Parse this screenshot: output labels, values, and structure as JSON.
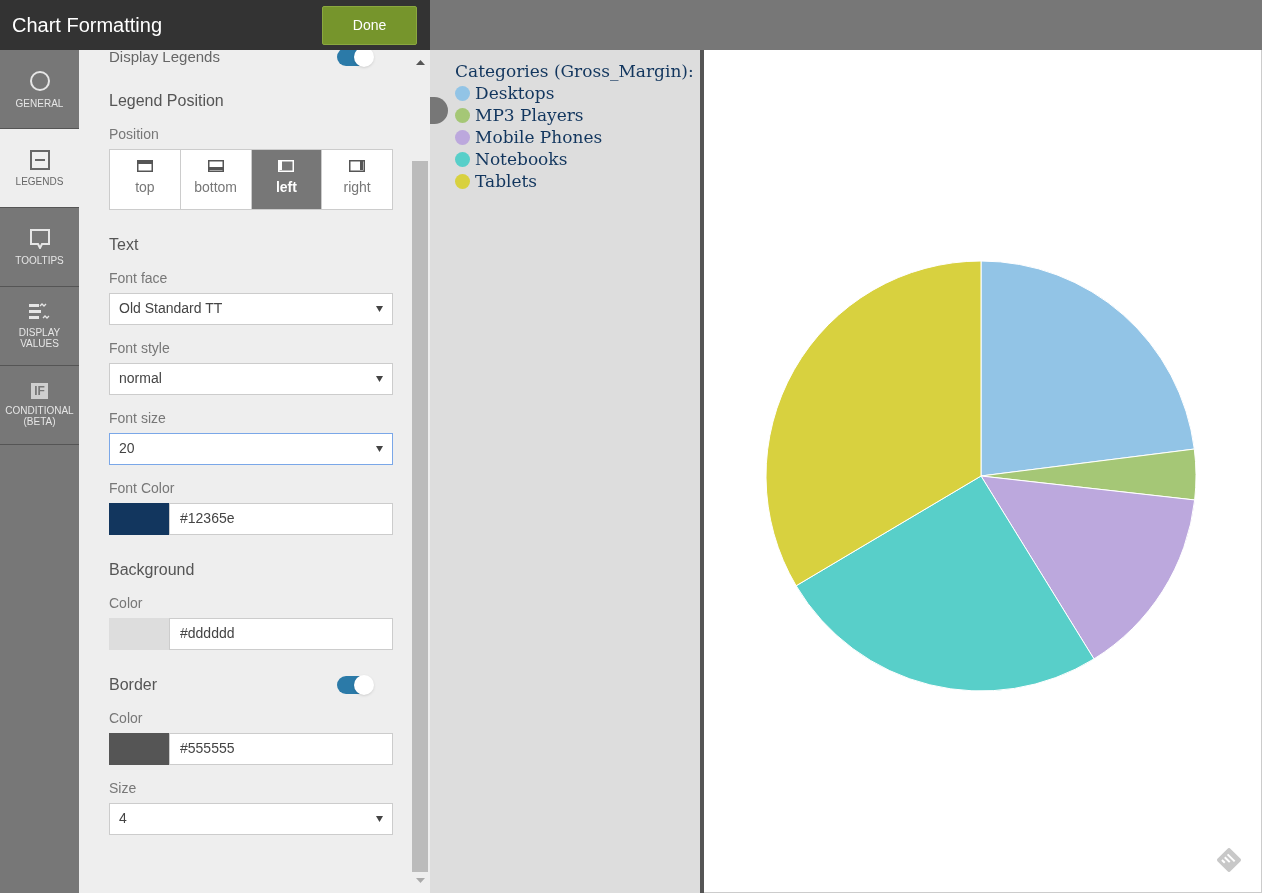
{
  "header": {
    "title": "Chart Formatting",
    "done_button": "Done"
  },
  "tabs": [
    {
      "kind": "circle",
      "label": "GENERAL",
      "selected": false
    },
    {
      "kind": "legend",
      "label": "LEGENDS",
      "selected": true
    },
    {
      "kind": "bubble",
      "label": "TOOLTIPS",
      "selected": false
    },
    {
      "kind": "values",
      "label": "DISPLAY VALUES",
      "selected": false
    },
    {
      "kind": "if",
      "badge": "IF",
      "label": "CONDITIONAL (BETA)",
      "selected": false
    }
  ],
  "panel": {
    "display_legends": {
      "label": "Display Legends",
      "on": true
    },
    "legend_position": {
      "heading": "Legend Position",
      "label": "Position",
      "options": [
        {
          "kind": "top",
          "label": "top",
          "selected": false
        },
        {
          "kind": "bottom",
          "label": "bottom",
          "selected": false
        },
        {
          "kind": "left",
          "label": "left",
          "selected": true
        },
        {
          "kind": "right",
          "label": "right",
          "selected": false
        }
      ]
    },
    "text": {
      "heading": "Text",
      "font_face": {
        "label": "Font face",
        "value": "Old Standard TT",
        "focused": false
      },
      "font_style": {
        "label": "Font style",
        "value": "normal",
        "focused": false
      },
      "font_size": {
        "label": "Font size",
        "value": "20",
        "focused": true
      },
      "font_color": {
        "label": "Font Color",
        "value": "#12365e",
        "color": "#12365e"
      }
    },
    "background": {
      "heading": "Background",
      "color_field": {
        "label": "Color",
        "value": "#dddddd",
        "color": "#dddddd"
      }
    },
    "border": {
      "heading": "Border",
      "on": true,
      "color_field": {
        "label": "Color",
        "value": "#555555",
        "color": "#555555"
      },
      "size": {
        "label": "Size",
        "value": "4",
        "focused": false
      }
    }
  },
  "legend": {
    "title": "Categories (Gross_Margin):",
    "items": [
      {
        "label": "Desktops",
        "color": "#92c4e6"
      },
      {
        "label": "MP3 Players",
        "color": "#a5c776"
      },
      {
        "label": "Mobile Phones",
        "color": "#bca8dd"
      },
      {
        "label": "Notebooks",
        "color": "#58cfc9"
      },
      {
        "label": "Tablets",
        "color": "#d8d13f"
      }
    ]
  }
}
